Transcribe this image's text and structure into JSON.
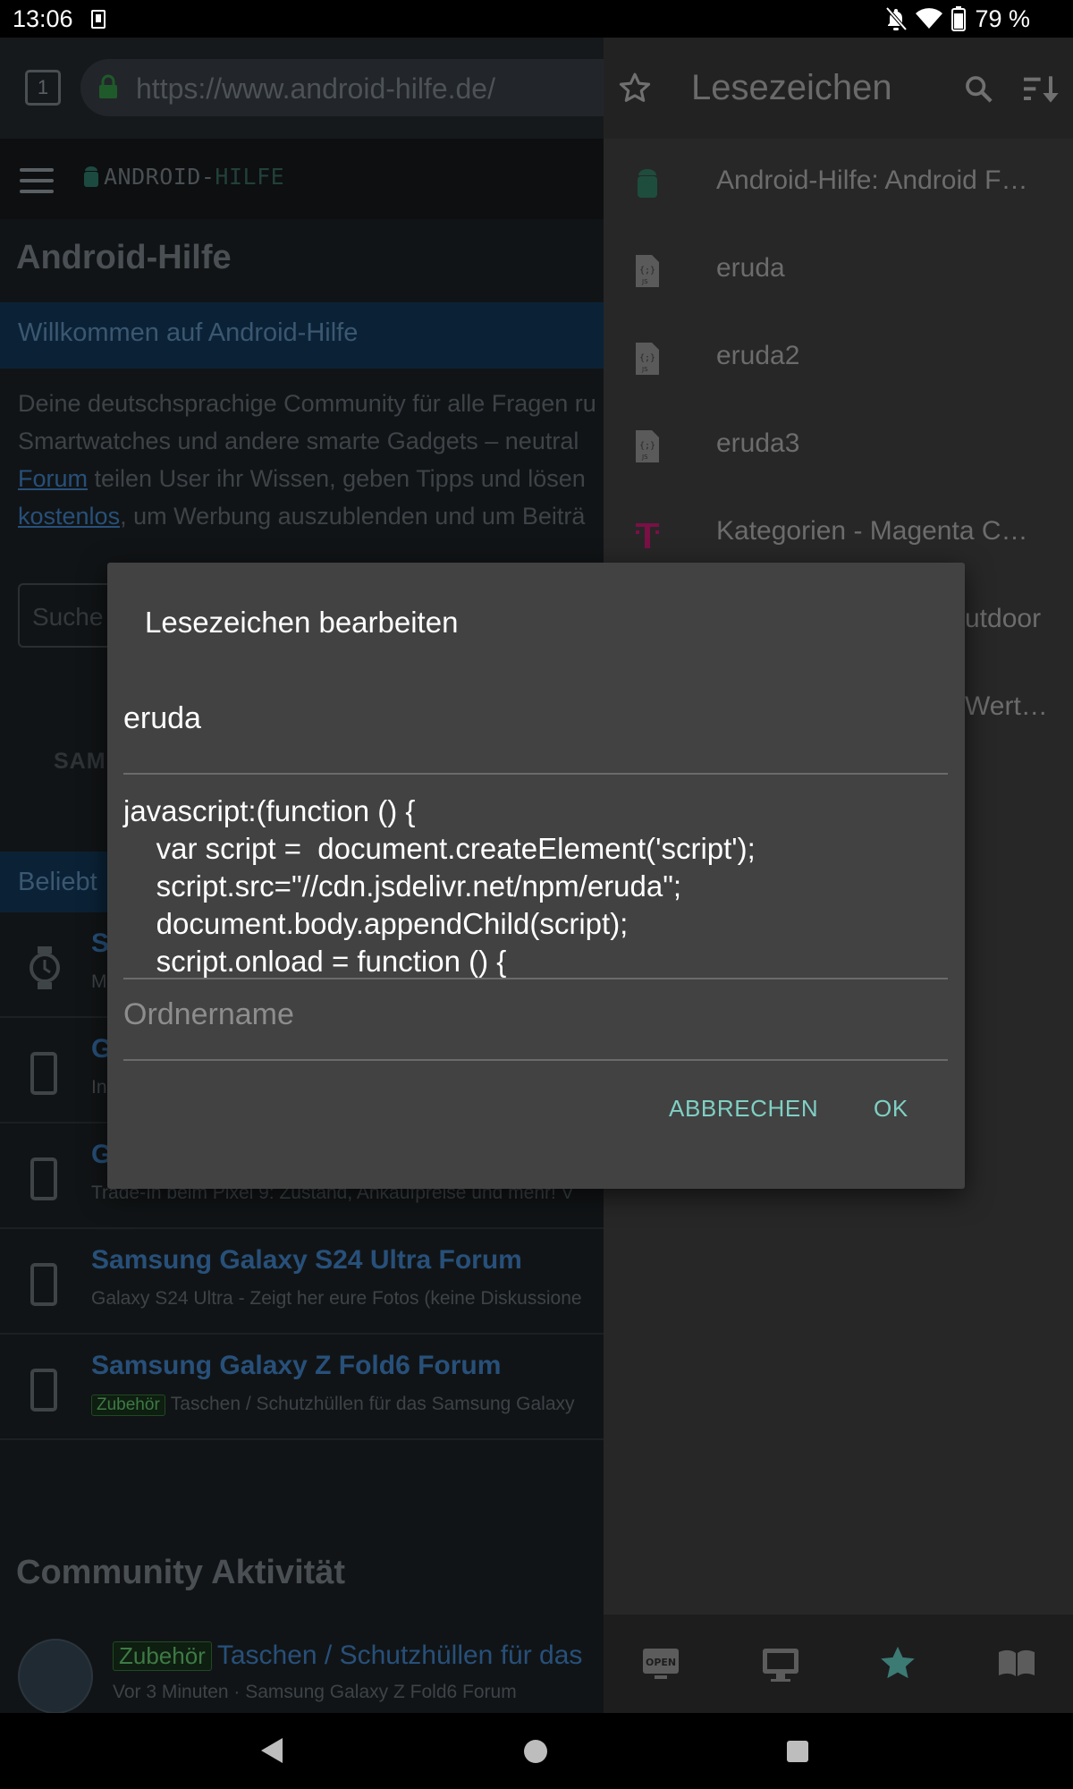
{
  "status_bar": {
    "time": "13:06",
    "battery_pct": "79 %"
  },
  "browser": {
    "tab_count": "1",
    "url": "https://www.android-hilfe.de/"
  },
  "site": {
    "logo_part1": "ANDROID-",
    "logo_part2": "HILFE",
    "page_title": "Android-Hilfe",
    "welcome": "Willkommen auf Android-Hilfe",
    "intro_lines": [
      "Deine deutschsprachige Community für alle Fragen ru",
      "Smartwatches und andere smarte Gadgets – neutral"
    ],
    "intro_line3_link": "Forum",
    "intro_line3_rest": " teilen User ihr Wissen, geben Tipps und lösen",
    "intro_line4_link": "kostenlos",
    "intro_line4_rest": ", um Werbung auszublenden und um Beiträ",
    "search_placeholder": "Suche",
    "brand_fragment": "SAM",
    "beliebt_fragment": "Beliebt",
    "forums": [
      {
        "title": "S",
        "sub": "M"
      },
      {
        "title": "G",
        "sub": "In"
      },
      {
        "title": "G",
        "sub": "Trade-In beim Pixel 9: Zustand, Ankaufpreise und mehr! V"
      },
      {
        "title": "Samsung Galaxy S24 Ultra Forum",
        "sub": "Galaxy S24 Ultra - Zeigt her eure Fotos (keine Diskussione"
      },
      {
        "title": "Samsung Galaxy Z Fold6 Forum",
        "tag": "Zubehör",
        "sub": "Taschen / Schutzhüllen für das Samsung Galaxy"
      }
    ],
    "community_title": "Community Aktivität",
    "activity": {
      "tag": "Zubehör",
      "title": "Taschen / Schutzhüllen für das",
      "meta": "Vor 3 Minuten · Samsung Galaxy Z Fold6 Forum"
    }
  },
  "drawer": {
    "title": "Lesezeichen",
    "bookmarks": [
      {
        "label": "Android-Hilfe: Android F…",
        "icon": "android-icon"
      },
      {
        "label": "eruda",
        "icon": "js-file-icon"
      },
      {
        "label": "eruda2",
        "icon": "js-file-icon"
      },
      {
        "label": "eruda3",
        "icon": "js-file-icon"
      },
      {
        "label": "Kategorien - Magenta C…",
        "icon": "telekom-icon"
      },
      {
        "label": "utdoor",
        "icon": ""
      },
      {
        "label": "Wert…",
        "icon": ""
      }
    ],
    "footer_open_label": "OPEN"
  },
  "dialog": {
    "title": "Lesezeichen bearbeiten",
    "name_value": "eruda",
    "url_value": "javascript:(function () {\n    var script =  document.createElement('script');\n    script.src=\"//cdn.jsdelivr.net/npm/eruda\";\n    document.body.appendChild(script);\n    script.onload = function () {",
    "folder_placeholder": "Ordnername",
    "cancel_label": "ABBRECHEN",
    "ok_label": "OK"
  },
  "colors": {
    "accent": "#7fd0c4",
    "dialog_bg": "#424242",
    "drawer_bg": "#272727"
  }
}
